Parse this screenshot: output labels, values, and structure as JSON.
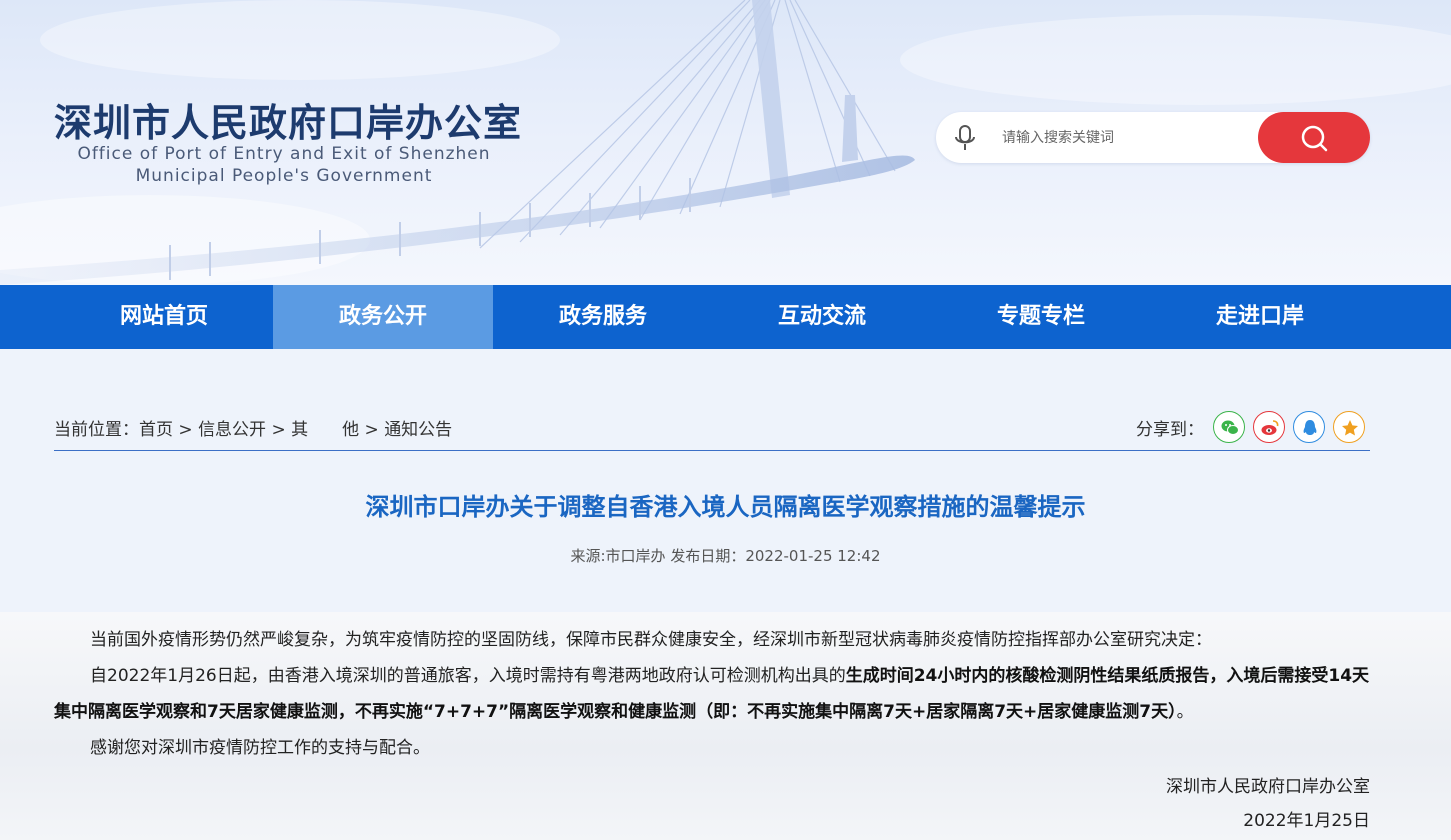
{
  "header": {
    "title": "深圳市人民政府口岸办公室",
    "subtitle_line1": "Office of Port of Entry and Exit of Shenzhen",
    "subtitle_line2": "Municipal People's Government",
    "search_placeholder": "请输入搜索关键词"
  },
  "nav": {
    "items": [
      {
        "label": "网站首页"
      },
      {
        "label": "政务公开"
      },
      {
        "label": "政务服务"
      },
      {
        "label": "互动交流"
      },
      {
        "label": "专题专栏"
      },
      {
        "label": "走进口岸"
      }
    ],
    "active_index": 1
  },
  "breadcrumb": {
    "prefix": "当前位置：",
    "items": [
      "首页",
      "信息公开",
      "其　　他",
      "通知公告"
    ],
    "separator": " > "
  },
  "share": {
    "label": "分享到：",
    "icons": [
      {
        "name": "wechat-icon",
        "color": "#3bb44a"
      },
      {
        "name": "weibo-icon",
        "color": "#e5373c"
      },
      {
        "name": "qq-icon",
        "color": "#2f8ce0"
      },
      {
        "name": "qzone-icon",
        "color": "#f0a020"
      }
    ]
  },
  "article": {
    "title": "深圳市口岸办关于调整自香港入境人员隔离医学观察措施的温馨提示",
    "meta": "来源:市口岸办 发布日期：2022-01-25 12:42",
    "para1": "当前国外疫情形势仍然严峻复杂，为筑牢疫情防控的坚固防线，保障市民群众健康安全，经深圳市新型冠状病毒肺炎疫情防控指挥部办公室研究决定：",
    "para2_normal": "自2022年1月26日起，由香港入境深圳的普通旅客，入境时需持有粤港两地政府认可检测机构出具的",
    "para2_bold1": "生成时间24小时内的核酸检测阴性结果纸质报告，入境后需接受14天集中隔离医学观察和7天居家健康监测，不再实施“7+7+7”隔离医学观察和健康监测（即：不再实施集中隔离7天+居家隔离7天+居家健康监测7天）",
    "para2_end": "。",
    "para3": "感谢您对深圳市疫情防控工作的支持与配合。",
    "signature": "深圳市人民政府口岸办公室",
    "date": "2022年1月25日"
  }
}
